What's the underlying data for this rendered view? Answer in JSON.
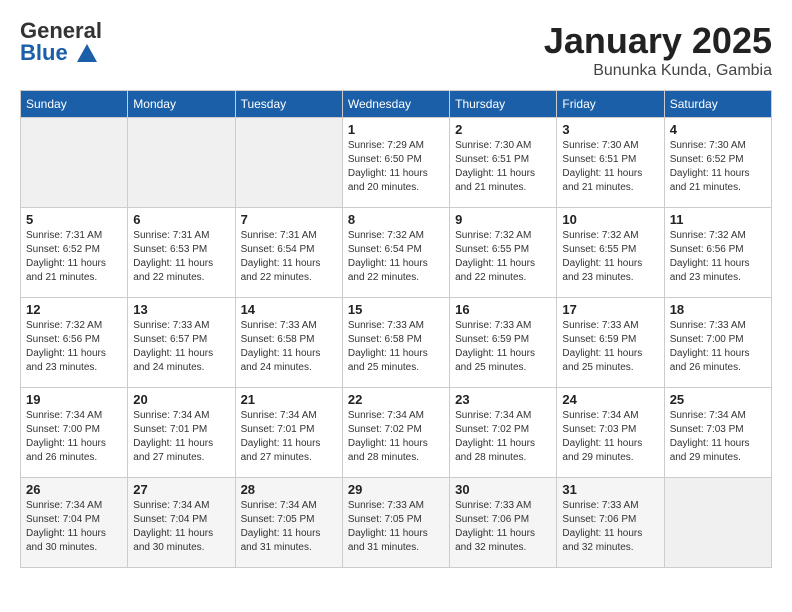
{
  "header": {
    "logo_general": "General",
    "logo_blue": "Blue",
    "month": "January 2025",
    "location": "Bununka Kunda, Gambia"
  },
  "weekdays": [
    "Sunday",
    "Monday",
    "Tuesday",
    "Wednesday",
    "Thursday",
    "Friday",
    "Saturday"
  ],
  "weeks": [
    [
      {
        "day": "",
        "info": ""
      },
      {
        "day": "",
        "info": ""
      },
      {
        "day": "",
        "info": ""
      },
      {
        "day": "1",
        "info": "Sunrise: 7:29 AM\nSunset: 6:50 PM\nDaylight: 11 hours\nand 20 minutes."
      },
      {
        "day": "2",
        "info": "Sunrise: 7:30 AM\nSunset: 6:51 PM\nDaylight: 11 hours\nand 21 minutes."
      },
      {
        "day": "3",
        "info": "Sunrise: 7:30 AM\nSunset: 6:51 PM\nDaylight: 11 hours\nand 21 minutes."
      },
      {
        "day": "4",
        "info": "Sunrise: 7:30 AM\nSunset: 6:52 PM\nDaylight: 11 hours\nand 21 minutes."
      }
    ],
    [
      {
        "day": "5",
        "info": "Sunrise: 7:31 AM\nSunset: 6:52 PM\nDaylight: 11 hours\nand 21 minutes."
      },
      {
        "day": "6",
        "info": "Sunrise: 7:31 AM\nSunset: 6:53 PM\nDaylight: 11 hours\nand 22 minutes."
      },
      {
        "day": "7",
        "info": "Sunrise: 7:31 AM\nSunset: 6:54 PM\nDaylight: 11 hours\nand 22 minutes."
      },
      {
        "day": "8",
        "info": "Sunrise: 7:32 AM\nSunset: 6:54 PM\nDaylight: 11 hours\nand 22 minutes."
      },
      {
        "day": "9",
        "info": "Sunrise: 7:32 AM\nSunset: 6:55 PM\nDaylight: 11 hours\nand 22 minutes."
      },
      {
        "day": "10",
        "info": "Sunrise: 7:32 AM\nSunset: 6:55 PM\nDaylight: 11 hours\nand 23 minutes."
      },
      {
        "day": "11",
        "info": "Sunrise: 7:32 AM\nSunset: 6:56 PM\nDaylight: 11 hours\nand 23 minutes."
      }
    ],
    [
      {
        "day": "12",
        "info": "Sunrise: 7:32 AM\nSunset: 6:56 PM\nDaylight: 11 hours\nand 23 minutes."
      },
      {
        "day": "13",
        "info": "Sunrise: 7:33 AM\nSunset: 6:57 PM\nDaylight: 11 hours\nand 24 minutes."
      },
      {
        "day": "14",
        "info": "Sunrise: 7:33 AM\nSunset: 6:58 PM\nDaylight: 11 hours\nand 24 minutes."
      },
      {
        "day": "15",
        "info": "Sunrise: 7:33 AM\nSunset: 6:58 PM\nDaylight: 11 hours\nand 25 minutes."
      },
      {
        "day": "16",
        "info": "Sunrise: 7:33 AM\nSunset: 6:59 PM\nDaylight: 11 hours\nand 25 minutes."
      },
      {
        "day": "17",
        "info": "Sunrise: 7:33 AM\nSunset: 6:59 PM\nDaylight: 11 hours\nand 25 minutes."
      },
      {
        "day": "18",
        "info": "Sunrise: 7:33 AM\nSunset: 7:00 PM\nDaylight: 11 hours\nand 26 minutes."
      }
    ],
    [
      {
        "day": "19",
        "info": "Sunrise: 7:34 AM\nSunset: 7:00 PM\nDaylight: 11 hours\nand 26 minutes."
      },
      {
        "day": "20",
        "info": "Sunrise: 7:34 AM\nSunset: 7:01 PM\nDaylight: 11 hours\nand 27 minutes."
      },
      {
        "day": "21",
        "info": "Sunrise: 7:34 AM\nSunset: 7:01 PM\nDaylight: 11 hours\nand 27 minutes."
      },
      {
        "day": "22",
        "info": "Sunrise: 7:34 AM\nSunset: 7:02 PM\nDaylight: 11 hours\nand 28 minutes."
      },
      {
        "day": "23",
        "info": "Sunrise: 7:34 AM\nSunset: 7:02 PM\nDaylight: 11 hours\nand 28 minutes."
      },
      {
        "day": "24",
        "info": "Sunrise: 7:34 AM\nSunset: 7:03 PM\nDaylight: 11 hours\nand 29 minutes."
      },
      {
        "day": "25",
        "info": "Sunrise: 7:34 AM\nSunset: 7:03 PM\nDaylight: 11 hours\nand 29 minutes."
      }
    ],
    [
      {
        "day": "26",
        "info": "Sunrise: 7:34 AM\nSunset: 7:04 PM\nDaylight: 11 hours\nand 30 minutes."
      },
      {
        "day": "27",
        "info": "Sunrise: 7:34 AM\nSunset: 7:04 PM\nDaylight: 11 hours\nand 30 minutes."
      },
      {
        "day": "28",
        "info": "Sunrise: 7:34 AM\nSunset: 7:05 PM\nDaylight: 11 hours\nand 31 minutes."
      },
      {
        "day": "29",
        "info": "Sunrise: 7:33 AM\nSunset: 7:05 PM\nDaylight: 11 hours\nand 31 minutes."
      },
      {
        "day": "30",
        "info": "Sunrise: 7:33 AM\nSunset: 7:06 PM\nDaylight: 11 hours\nand 32 minutes."
      },
      {
        "day": "31",
        "info": "Sunrise: 7:33 AM\nSunset: 7:06 PM\nDaylight: 11 hours\nand 32 minutes."
      },
      {
        "day": "",
        "info": ""
      }
    ]
  ]
}
